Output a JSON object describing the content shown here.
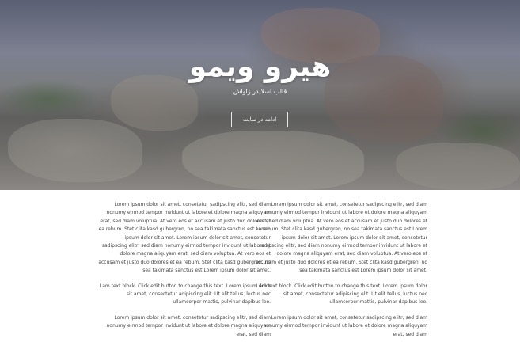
{
  "hero": {
    "title": "هیرو ویمو",
    "subtitle": "قالب اسلایدر زاواش",
    "button_label": "ادامه در سایت"
  },
  "content": {
    "right_column": [
      "Lorem ipsum dolor sit amet, consetetur sadipscing elitr, sed diam nonumy eirmod tempor invidunt ut labore et dolore magna aliquyam erat, sed diam voluptua. At vero eos et accusam et justo duo dolores et ea rebum. Stet clita kasd gubergren, no sea takimata sanctus est Lorem ipsum dolor sit amet. Lorem ipsum dolor sit amet, consetetur sadipscing elitr, sed diam nonumy eirmod tempor invidunt ut labore et dolore magna aliquyam erat, sed diam voluptua. At vero eos et accusam et justo duo dolores et ea rebum. Stet clita kasd gubergren, no sea takimata sanctus est Lorem ipsum dolor sit amet.",
      "I am text block. Click edit button to change this text. Lorem ipsum dolor sit amet, consectetur adipiscing elit. Ut elit tellus, luctus nec ullamcorper mattis, pulvinar dapibus leo.",
      "Lorem ipsum dolor sit amet, consetetur sadipscing elitr, sed diam nonumy eirmod tempor invidunt ut labore et dolore magna aliquyam erat, sed diam"
    ],
    "left_column": [
      "Lorem ipsum dolor sit amet, consetetur sadipscing elitr, sed diam nonumy eirmod tempor invidunt ut labore et dolore magna aliquyam erat, sed diam voluptua. At vero eos et accusam et justo duo dolores et ea rebum. Stet clita kasd gubergren, no sea takimata sanctus est Lorem ipsum dolor sit amet. Lorem ipsum dolor sit amet, consetetur sadipscing elitr, sed diam nonumy eirmod tempor invidunt ut labore et dolore magna aliquyam erat, sed diam voluptua. At vero eos et accusam et justo duo dolores et ea rebum. Stet clita kasd gubergren, no sea takimata sanctus est Lorem ipsum dolor sit amet.",
      "I am text block. Click edit button to change this text. Lorem ipsum dolor sit amet, consectetur adipiscing elit. Ut elit tellus, luctus nec ullamcorper mattis, pulvinar dapibus leo.",
      "Lorem ipsum dolor sit amet, consetetur sadipscing elitr, sed diam nonumy eirmod tempor invidunt ut labore et dolore magna aliquyam erat, sed diam"
    ]
  }
}
